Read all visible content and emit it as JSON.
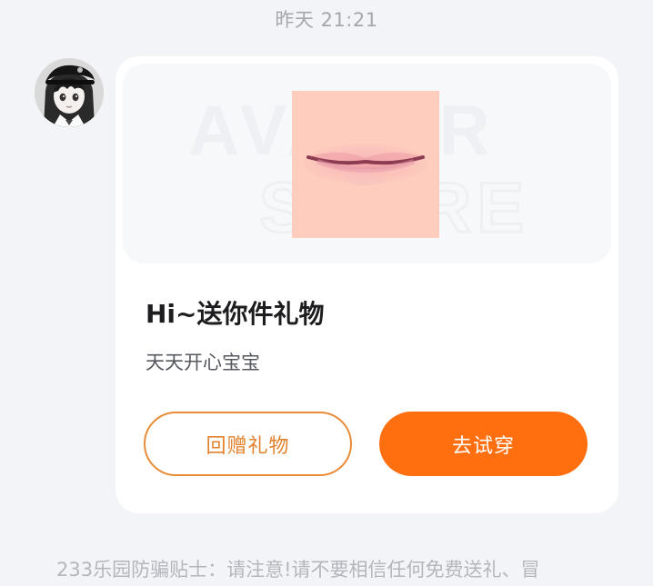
{
  "chat": {
    "timestamp": "昨天 21:21"
  },
  "sender": {
    "avatar_icon": "anime-girl-avatar"
  },
  "gift_card": {
    "image_icon": "lips-makeup-preview",
    "watermark_text_top": "AVATAR",
    "watermark_text_bottom": "STORE",
    "title": "Hi~送你件礼物",
    "message": "天天开心宝宝",
    "return_gift_label": "回赠礼物",
    "try_on_label": "去试穿"
  },
  "footer": {
    "anti_fraud_tip": "233乐园防骗贴士：请注意!请不要相信任何免费送礼、冒"
  },
  "colors": {
    "page_background": "#f3f4f8",
    "card_background": "#ffffff",
    "accent_orange": "#ff6f0f",
    "outline_orange": "#e98a35",
    "lip_preview_background": "#ffcdbd"
  }
}
